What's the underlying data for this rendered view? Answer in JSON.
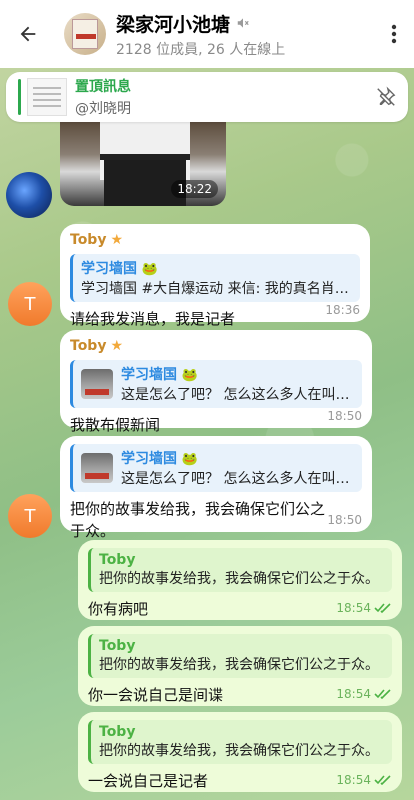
{
  "header": {
    "title": "梁家河小池塘",
    "subtitle": "2128 位成員, 26 人在線上"
  },
  "pinned": {
    "title": "置頂訊息",
    "sender": "@刘晓明"
  },
  "photo": {
    "time": "18:22"
  },
  "messages": [
    {
      "sender": "Toby",
      "reply_title": "学习墙国",
      "reply_text": "学习墙国 #大自爆运动 来信:  我的真名肖…",
      "text": "请给我发消息，我是记者",
      "time": "18:36"
    },
    {
      "sender": "Toby",
      "reply_title": "学习墙国",
      "reply_text": "这是怎么了吧？ 怎么这么多人在叫好…",
      "text": "我散布假新闻",
      "time": "18:50"
    },
    {
      "sender": "",
      "reply_title": "学习墙国",
      "reply_text": "这是怎么了吧？ 怎么这么多人在叫好…",
      "text": "把你的故事发给我，我会确保它们公之于众。",
      "time": "18:50"
    },
    {
      "reply_title": "Toby",
      "reply_text": "把你的故事发给我，我会确保它们公之于众。",
      "text": "你有病吧",
      "time": "18:54"
    },
    {
      "reply_title": "Toby",
      "reply_text": "把你的故事发给我，我会确保它们公之于众。",
      "text": "你一会说自己是间谍",
      "time": "18:54"
    },
    {
      "reply_title": "Toby",
      "reply_text": "把你的故事发给我，我会确保它们公之于众。",
      "text": "一会说自己是记者",
      "time": "18:54"
    }
  ],
  "avatar_letter": "T",
  "colors": {
    "accent_green": "#2ca84d",
    "sender_orange": "#c88a2b",
    "reply_blue": "#2d8ae0"
  }
}
